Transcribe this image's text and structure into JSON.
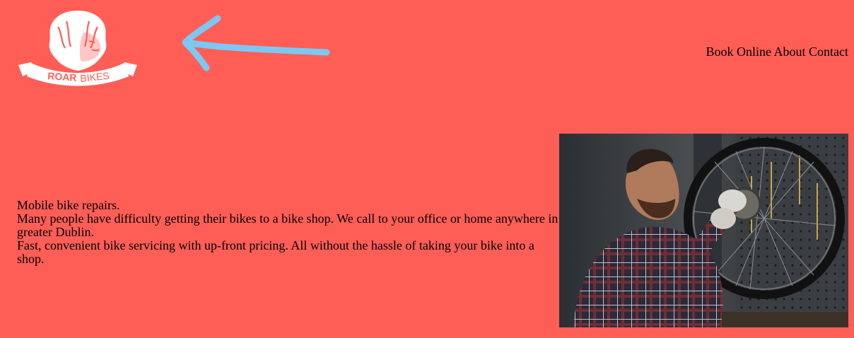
{
  "logo": {
    "text_bold": "ROAR",
    "text_light": "BIKES",
    "icon": "lion-head-icon"
  },
  "annotation": {
    "icon": "arrow-left-icon",
    "color": "#7cc8f2"
  },
  "nav": {
    "items": [
      "Book Online",
      "About",
      "Contact"
    ]
  },
  "intro": {
    "lines": [
      "Mobile bike repairs.",
      "Many people have difficulty getting their bikes to a bike shop. We call to your office or home anywhere in greater Dublin.",
      "Fast, convenient bike servicing with up-front pricing. All without the hassle of taking your bike into a shop."
    ]
  },
  "colors": {
    "background": "#ff5e57",
    "logo": "#ffffff",
    "logo_text": "#ff5e57"
  }
}
